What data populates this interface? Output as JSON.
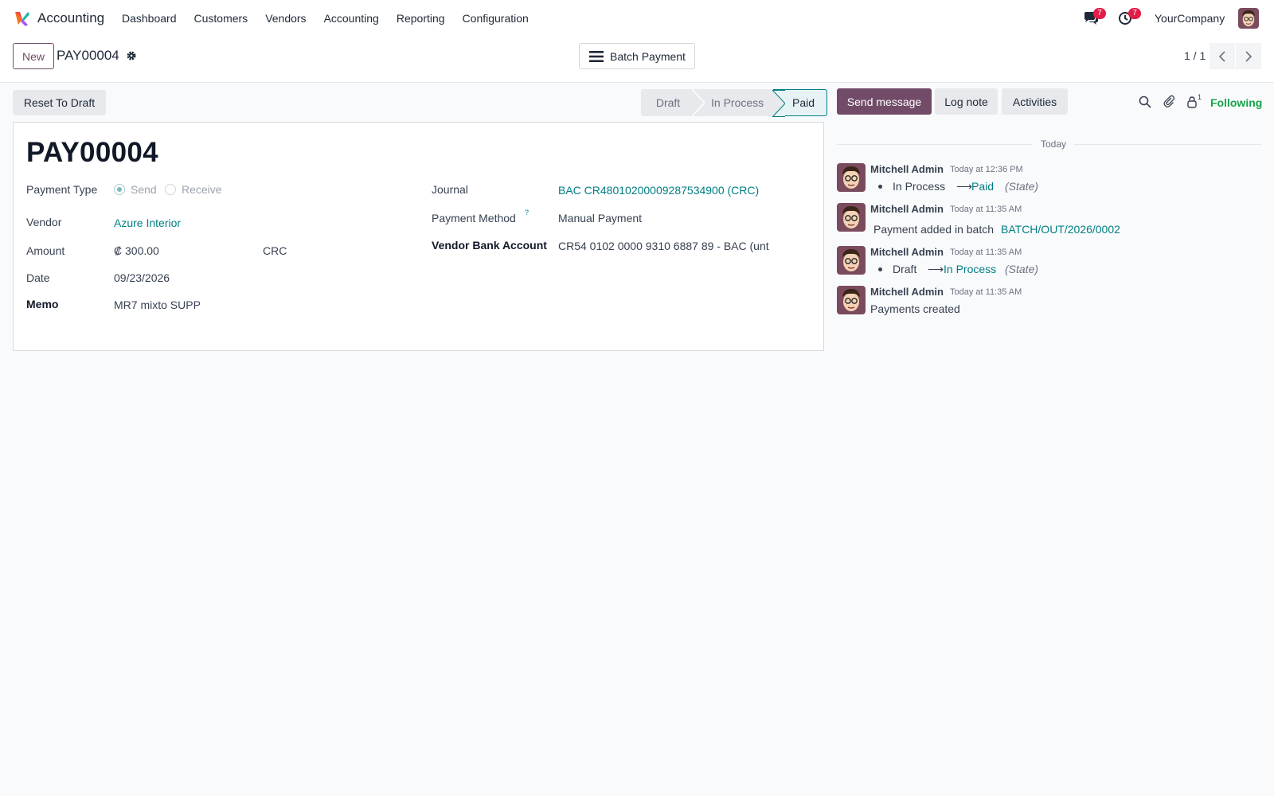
{
  "nav": {
    "app_name": "Accounting",
    "menu": [
      "Dashboard",
      "Customers",
      "Vendors",
      "Accounting",
      "Reporting",
      "Configuration"
    ],
    "messages_badge": "7",
    "activities_badge": "7",
    "company": "YourCompany"
  },
  "control": {
    "new_label": "New",
    "record_name": "PAY00004",
    "batch_label": "Batch Payment",
    "pager": "1 / 1"
  },
  "statusbar": {
    "reset_label": "Reset To Draft",
    "stages": [
      "Draft",
      "In Process",
      "Paid"
    ],
    "active_stage": "Paid"
  },
  "form": {
    "title": "PAY00004",
    "payment_type_label": "Payment Type",
    "payment_type_options": [
      "Send",
      "Receive"
    ],
    "payment_type_selected": "Send",
    "vendor_label": "Vendor",
    "vendor_value": "Azure Interior",
    "amount_label": "Amount",
    "amount_value": "₡ 300.00",
    "currency": "CRC",
    "date_label": "Date",
    "date_value": "09/23/2026",
    "memo_label": "Memo",
    "memo_value": "MR7 mixto SUPP",
    "journal_label": "Journal",
    "journal_value": "BAC CR48010200009287534900 (CRC)",
    "payment_method_label": "Payment Method",
    "payment_method_help": "?",
    "payment_method_value": "Manual Payment",
    "bank_account_label": "Vendor Bank Account",
    "bank_account_value": "CR54 0102 0000 9310 6887 89 - BAC (unt"
  },
  "chatter": {
    "send_message": "Send message",
    "log_note": "Log note",
    "activities": "Activities",
    "follower_count": "1",
    "following": "Following",
    "day_label": "Today",
    "messages": [
      {
        "author": "Mitchell Admin",
        "date": "Today at 12:36 PM",
        "from": "In Process",
        "to": "Paid",
        "field": "(State)"
      },
      {
        "author": "Mitchell Admin",
        "date": "Today at 11:35 AM",
        "text": "Payment added in batch",
        "link": "BATCH/OUT/2026/0002"
      },
      {
        "author": "Mitchell Admin",
        "date": "Today at 11:35 AM",
        "from": "Draft",
        "to": "In Process",
        "field": "(State)"
      },
      {
        "author": "Mitchell Admin",
        "date": "Today at 11:35 AM",
        "text": "Payments created"
      }
    ]
  },
  "colors": {
    "brand": "#714b67",
    "link": "#017e84",
    "following": "#16a34a",
    "badge": "#e11d48"
  }
}
